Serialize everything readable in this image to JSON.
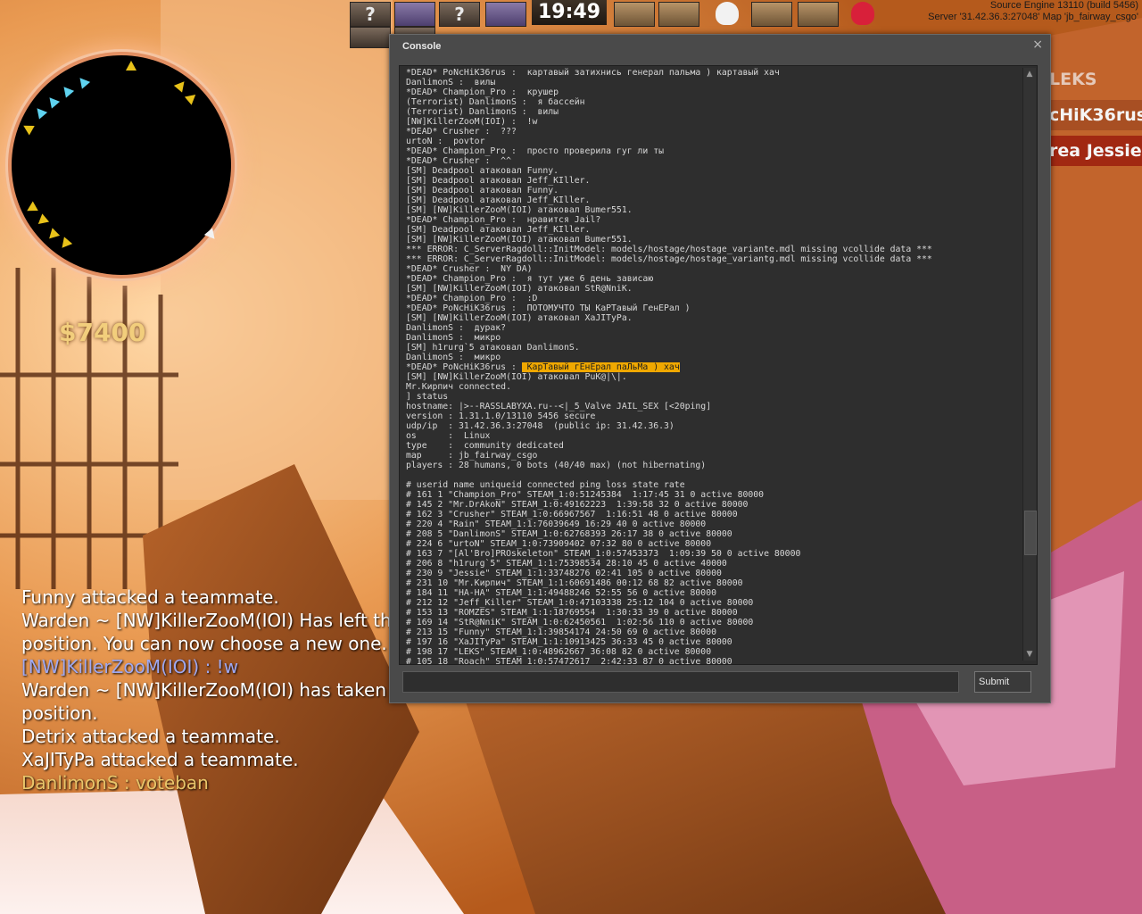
{
  "hud": {
    "timer": "19:49",
    "money": "$7400",
    "slot_unknown": "?",
    "engine_info": "Source Engine 13110 (build 5456)",
    "server_info": "Server '31.42.36.3:27048' Map 'jb_fairway_csgo'"
  },
  "scoreboard_right": [
    "LEKS",
    "cHiK36rus",
    "rea Jessie"
  ],
  "chat": {
    "lines": [
      {
        "text": "Funny attacked a teammate.",
        "style": "normal"
      },
      {
        "text": "Warden ~ [NW]KillerZooM(IOI) Has left the Co",
        "style": "normal"
      },
      {
        "text": "position. You can now choose a new one.",
        "style": "normal"
      },
      {
        "text": "[NW]KillerZooM(IOI) :  !w",
        "style": "player"
      },
      {
        "text": "Warden ~ [NW]KillerZooM(IOI) has taken the (",
        "style": "normal"
      },
      {
        "text": "position.",
        "style": "normal"
      },
      {
        "text": "Detrix attacked a teammate.",
        "style": "normal"
      },
      {
        "text": "XaJITyPa attacked a teammate.",
        "style": "normal"
      },
      {
        "text": "DanlimonS :  voteban",
        "style": "ct"
      }
    ]
  },
  "console": {
    "title": "Console",
    "close_glyph": "×",
    "submit_label": "Submit",
    "input_value": "",
    "lines": [
      "*DEAD* PoNcHiK36rus :  картавый затихнись генерал пальма ) картавый хач",
      "DanlimonS :  вилы",
      "*DEAD* Champion_Pro :  крушер",
      "(Terrorist) DanlimonS :  я бассейн",
      "(Terrorist) DanlimonS :  вилы",
      "[NW]KillerZooM(IOI) :  !w",
      "*DEAD* Crusher :  ???",
      "urtoN :  povtor",
      "*DEAD* Champion_Pro :  просто проверила гуг ли ты",
      "*DEAD* Crusher :  ^^",
      "[SM] Deadpool атаковал Funny.",
      "[SM] Deadpool атаковал Jeff_KIller.",
      "[SM] Deadpool атаковал Funny.",
      "[SM] Deadpool атаковал Jeff_KIller.",
      "[SM] [NW]KillerZooM(IOI) атаковал Bumer551.",
      "*DEAD* Champion_Pro :  нравится Jail?",
      "[SM] Deadpool атаковал Jeff_KIller.",
      "[SM] [NW]KillerZooM(IOI) атаковал Bumer551.",
      "*** ERROR: C_ServerRagdoll::InitModel: models/hostage/hostage_variante.mdl missing vcollide data ***",
      "*** ERROR: C_ServerRagdoll::InitModel: models/hostage/hostage_variantg.mdl missing vcollide data ***",
      "*DEAD* Crusher :  NY DA)",
      "*DEAD* Champion_Pro :  я тут уже 6 день зависаю",
      "[SM] [NW]KillerZooM(IOI) атаковал StR@NniK.",
      "*DEAD* Champion_Pro :  :D",
      "*DEAD* PoNcHiK36rus :  ПОТОМУЧТО ТЫ КаРТавый ГенЕРал )",
      "[SM] [NW]KillerZooM(IOI) атаковал XaJITyPa.",
      "DanlimonS :  дурак?",
      "DanlimonS :  микро",
      "[SM] h1rurg`5 атаковал DanlimonS.",
      "DanlimonS :  микро",
      "*DEAD* PoNcHiK36rus :  КарТавый гЕнЕрал паЛьМа ) хач",
      "[SM] [NW]KillerZooM(IOI) атаковал PuK@|\\|.",
      "Mr.Кирпич connected.",
      "] status",
      "hostname: |>--RASSLABYXA.ru--<|_5_Valve JAIL_SEX [<20ping]",
      "version : 1.31.1.0/13110 5456 secure",
      "udp/ip  : 31.42.36.3:27048  (public ip: 31.42.36.3)",
      "os      :  Linux",
      "type    :  community dedicated",
      "map     : jb_fairway_csgo",
      "players : 28 humans, 0 bots (40/40 max) (not hibernating)",
      "",
      "# userid name uniqueid connected ping loss state rate",
      "# 161 1 \"Champion_Pro\" STEAM_1:0:51245384  1:17:45 31 0 active 80000",
      "# 145 2 \"Mr.DrAkoN\" STEAM_1:0:49162223  1:39:58 32 0 active 80000",
      "# 162 3 \"Crusher\" STEAM_1:0:66967567  1:16:51 48 0 active 80000",
      "# 220 4 \"Rain\" STEAM_1:1:76039649 16:29 40 0 active 80000",
      "# 208 5 \"DanlimonS\" STEAM_1:0:62768393 26:17 38 0 active 80000",
      "# 224 6 \"urtoN\" STEAM_1:0:73909402 07:32 80 0 active 80000",
      "# 163 7 \"[Al'Bro]PROskeleton\" STEAM_1:0:57453373  1:09:39 50 0 active 80000",
      "# 206 8 \"h1rurg`5\" STEAM_1:1:75398534 28:10 45 0 active 40000",
      "# 230 9 \"Jessie\" STEAM_1:1:33748276 02:41 105 0 active 80000",
      "# 231 10 \"Mr.Кирпич\" STEAM_1:1:60691486 00:12 68 82 active 80000",
      "# 184 11 \"НА-НА\" STEAM_1:1:49488246 52:55 56 0 active 80000",
      "# 212 12 \"Jeff_Killer\" STEAM_1:0:47103338 25:12 104 0 active 80000",
      "# 153 13 \"ROMZES\" STEAM_1:1:18769554  1:30:33 39 0 active 80000",
      "# 169 14 \"StR@NniK\" STEAM_1:0:62450561  1:02:56 110 0 active 80000",
      "# 213 15 \"Funny\" STEAM_1:1:39854174 24:50 69 0 active 80000",
      "# 197 16 \"XaJITyPa\" STEAM_1:1:10913425 36:33 45 0 active 80000",
      "# 198 17 \"LEKS\" STEAM_1:0:48962667 36:08 82 0 active 80000",
      "# 105 18 \"Roach\" STEAM_1:0:57472617  2:42:33 87 0 active 80000"
    ],
    "highlight_line": 30
  },
  "colors": {
    "console_bg": "#4a4a4a",
    "log_bg": "#2e2e2e",
    "highlight": "#f0a800",
    "money": "#f2ce7c",
    "radar_ring": "#e28f62"
  }
}
